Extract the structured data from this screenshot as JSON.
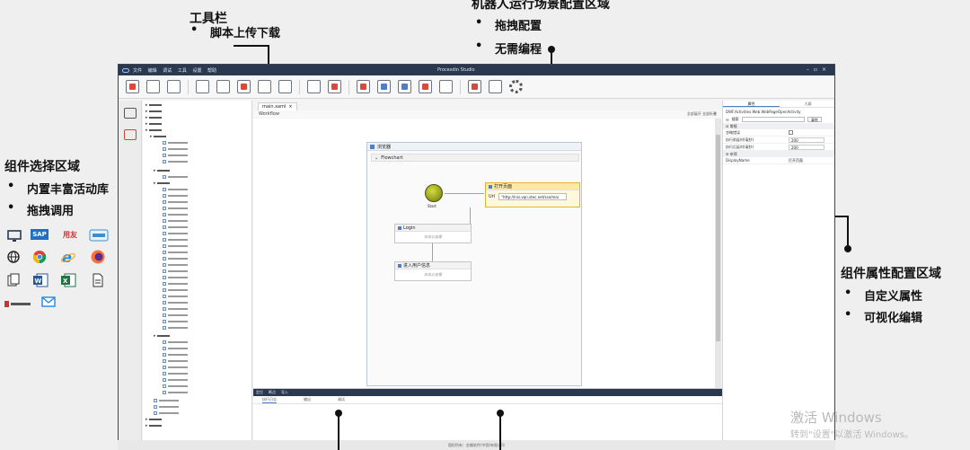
{
  "annotations": {
    "toolbar": {
      "title": "工具栏",
      "bullets": [
        "脚本上传下载"
      ]
    },
    "robot_scene": {
      "title": "机器人运行场景配置区域",
      "bullets": [
        "拖拽配置",
        "无需编程"
      ]
    },
    "component_select": {
      "title": "组件选择区域",
      "bullets": [
        "内置丰富活动库",
        "拖拽调用"
      ]
    },
    "property_config": {
      "title": "组件属性配置区域",
      "bullets": [
        "自定义属性",
        "可视化编辑"
      ]
    }
  },
  "logos": {
    "row1": [
      "monitor-icon",
      "sap-logo",
      "yonyou-logo",
      "browser-frame-icon"
    ],
    "row2": [
      "globe-icon",
      "chrome-logo",
      "ie-logo",
      "firefox-logo"
    ],
    "row3": [
      "copy-icon",
      "word-logo",
      "excel-logo",
      "document-icon"
    ],
    "row4": [
      "flow-logo",
      "mail-icon"
    ],
    "sap_text": "SAP",
    "yonyou_text": "用友"
  },
  "app": {
    "window_title": "Procesdin Studio",
    "menu": [
      "文件",
      "编辑",
      "调试",
      "工具",
      "设置",
      "帮助"
    ],
    "doc_tab": "main.xaml",
    "workflow_label": "Workflow",
    "workflow_right": "全部展开  全部折叠",
    "frame_title": "浏览器",
    "flowchart_title": "Flowchart",
    "start_label": "Start",
    "open_page": {
      "title": "打开页面",
      "url_label": "Url",
      "url_value": "\"http://lnis.vqn.stec.net/sso/mai"
    },
    "login": {
      "title": "Login",
      "placeholder": "双击以查看"
    },
    "enter_user": {
      "title": "进入用户信息",
      "placeholder": "双击以查看"
    },
    "bottom_tabs": [
      "执行日志",
      "输出",
      "调试"
    ],
    "bottom_head": [
      "定位",
      "断点",
      "导入"
    ],
    "props": {
      "tabs": [
        "属性",
        "大纲"
      ],
      "class_name": "DWF.Activities.Web.WebPageOpenActivity",
      "sort_label": "搜索",
      "clear_label": "清除",
      "cat1": "常规",
      "rows": [
        {
          "k": "忽略错误",
          "v": ""
        },
        {
          "k": "执行前延时(毫秒)",
          "v": "200"
        },
        {
          "k": "执行后延时(毫秒)",
          "v": "200"
        }
      ],
      "cat2": "杂项",
      "display_name_key": "DisplayName",
      "display_name_val": "打开页面"
    },
    "status_text": "版权所有：金蝶软件(中国)有限公司"
  },
  "watermark": {
    "line1": "激活 Windows",
    "line2": "转到\"设置\"以激活 Windows。"
  }
}
